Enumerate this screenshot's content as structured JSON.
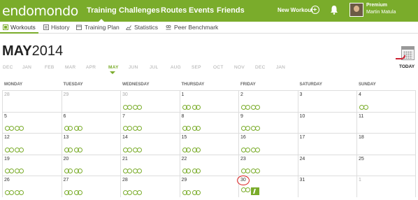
{
  "brand": {
    "logo": "endomondo",
    "accent": "#7aac2b"
  },
  "topnav": [
    {
      "label": "Training",
      "active": true
    },
    {
      "label": "Challenges"
    },
    {
      "label": "Routes"
    },
    {
      "label": "Events"
    },
    {
      "label": "Friends"
    }
  ],
  "new_workout_label": "New Workout",
  "user": {
    "tier": "Premium",
    "name": "Martin Matula"
  },
  "subnav": [
    {
      "label": "Workouts",
      "icon": "workouts-icon",
      "active": true
    },
    {
      "label": "History",
      "icon": "history-icon"
    },
    {
      "label": "Training Plan",
      "icon": "training-plan-icon"
    },
    {
      "label": "Statistics",
      "icon": "statistics-icon"
    },
    {
      "label": "Peer Benchmark",
      "icon": "peer-benchmark-icon"
    }
  ],
  "month": {
    "name": "MAY",
    "year": "2014"
  },
  "months": [
    "DEC",
    "JAN",
    "FEB",
    "MAR",
    "APR",
    "MAY",
    "JUN",
    "JUL",
    "AUG",
    "SEP",
    "OCT",
    "NOV",
    "DEC",
    "JAN"
  ],
  "current_month_index": 5,
  "today_label": "TODAY",
  "weekdays": [
    "MONDAY",
    "TUESDAY",
    "WEDNESDAY",
    "THURSDAY",
    "FRIDAY",
    "SATURDAY",
    "SUNDAY"
  ],
  "weeks": [
    [
      {
        "d": "28",
        "m": true,
        "b": 0
      },
      {
        "d": "29",
        "m": true,
        "b": 0
      },
      {
        "d": "30",
        "m": true,
        "b": 2
      },
      {
        "d": "1",
        "b": 2
      },
      {
        "d": "2",
        "b": 2
      },
      {
        "d": "3",
        "b": 0
      },
      {
        "d": "4",
        "b": 1
      }
    ],
    [
      {
        "d": "5",
        "b": 2
      },
      {
        "d": "6",
        "b": 2
      },
      {
        "d": "7",
        "b": 2
      },
      {
        "d": "8",
        "b": 2
      },
      {
        "d": "9",
        "b": 2
      },
      {
        "d": "10",
        "b": 0
      },
      {
        "d": "11",
        "b": 0
      }
    ],
    [
      {
        "d": "12",
        "b": 2
      },
      {
        "d": "13",
        "b": 2
      },
      {
        "d": "14",
        "b": 2
      },
      {
        "d": "15",
        "b": 2
      },
      {
        "d": "16",
        "b": 2
      },
      {
        "d": "17",
        "b": 0
      },
      {
        "d": "18",
        "b": 0
      }
    ],
    [
      {
        "d": "19",
        "b": 2
      },
      {
        "d": "20",
        "b": 2
      },
      {
        "d": "21",
        "b": 2
      },
      {
        "d": "22",
        "b": 2
      },
      {
        "d": "23",
        "b": 2
      },
      {
        "d": "24",
        "b": 0
      },
      {
        "d": "25",
        "b": 0
      }
    ],
    [
      {
        "d": "26",
        "b": 2
      },
      {
        "d": "27",
        "b": 2
      },
      {
        "d": "28",
        "b": 2
      },
      {
        "d": "29",
        "b": 2
      },
      {
        "d": "30",
        "b": 1,
        "run": true,
        "today": true
      },
      {
        "d": "31",
        "b": 0
      },
      {
        "d": "1",
        "m": true,
        "b": 0
      }
    ]
  ]
}
